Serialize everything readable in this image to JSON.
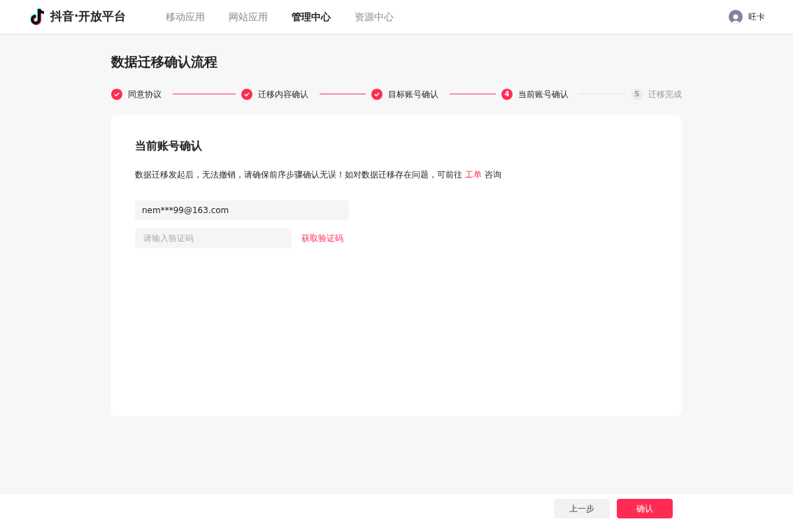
{
  "header": {
    "logo_text": "抖音·开放平台",
    "nav": [
      {
        "label": "移动应用",
        "selected": false
      },
      {
        "label": "网站应用",
        "selected": false
      },
      {
        "label": "管理中心",
        "selected": true
      },
      {
        "label": "资源中心",
        "selected": false
      }
    ],
    "user": "旺卡"
  },
  "page_title": "数据迁移确认流程",
  "steps": [
    {
      "kind": "done",
      "label": "同意协议"
    },
    {
      "kind": "done",
      "label": "迁移内容确认"
    },
    {
      "kind": "done",
      "label": "目标账号确认"
    },
    {
      "kind": "current",
      "number": "4",
      "label": "当前账号确认"
    },
    {
      "kind": "pending",
      "number": "5",
      "label": "迁移完成"
    }
  ],
  "card": {
    "title": "当前账号确认",
    "notice": "数据迁移发起后，无法撤销，请确保前序步骤确认无误！如对数据迁移存在问题，可前往",
    "notice_link": "工单",
    "notice_suffix": "咨询",
    "account_value": "nem***99@163.com",
    "code_placeholder": "请输入验证码",
    "get_code": "获取验证码"
  },
  "footer": {
    "back": "上一步",
    "confirm": "确认"
  }
}
